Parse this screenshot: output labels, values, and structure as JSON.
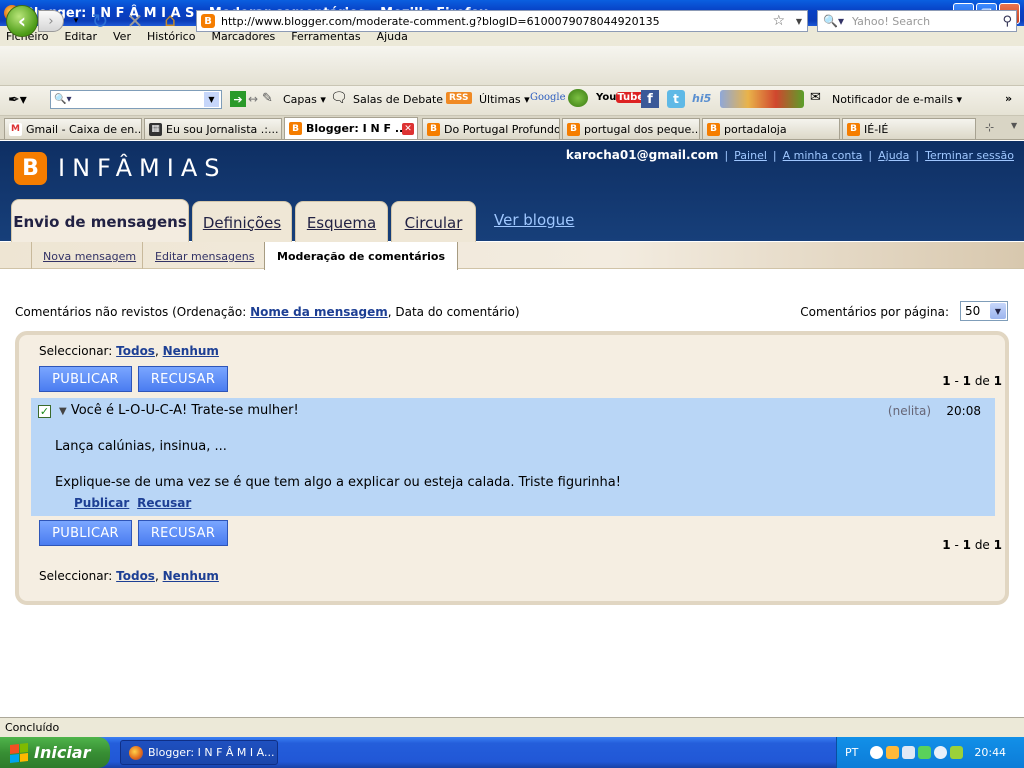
{
  "window": {
    "title": "Blogger: I N F Â M I A S - Moderar comentários - Mozilla Firefox"
  },
  "menu": [
    "Ficheiro",
    "Editar",
    "Ver",
    "Histórico",
    "Marcadores",
    "Ferramentas",
    "Ajuda"
  ],
  "nav": {
    "url": "http://www.blogger.com/moderate-comment.g?blogID=6100079078044920135",
    "search_placeholder": "Yahoo! Search"
  },
  "toolbar2": {
    "capas": "Capas",
    "salas": "Salas de Debate",
    "rss": "RSS",
    "ultimas": "Últimas",
    "google": "Google",
    "notificador": "Notificador de e-mails"
  },
  "tabs": [
    {
      "label": "Gmail - Caixa de en..."
    },
    {
      "label": "Eu sou Jornalista .:..."
    },
    {
      "label": "Blogger: I N F ..."
    },
    {
      "label": "Do Portugal Profundo"
    },
    {
      "label": "portugal dos peque..."
    },
    {
      "label": "portadaloja"
    },
    {
      "label": "IÉ-IÉ"
    }
  ],
  "blog": {
    "name": "INFÂMIAS",
    "email": "karocha01@gmail.com",
    "links": [
      "Painel",
      "A minha conta",
      "Ajuda",
      "Terminar sessão"
    ],
    "main_tabs": [
      "Envio de mensagens",
      "Definições",
      "Esquema",
      "Circular"
    ],
    "view_blog": "Ver blogue",
    "sub_tabs": [
      "Nova mensagem",
      "Editar mensagens",
      "Moderação de comentários"
    ]
  },
  "moderation": {
    "sort_prefix": "Comentários não revistos (Ordenação:",
    "sort_name": "Nome da mensagem",
    "sort_rest": ", Data do comentário)",
    "per_page_label": "Comentários por página:",
    "per_page_value": "50",
    "select_label": "Seleccionar:",
    "select_all": "Todos",
    "select_none": "Nenhum",
    "publish": "PUBLICAR",
    "reject": "RECUSAR",
    "pager": {
      "from": "1",
      "to": "1",
      "of": "de",
      "total": "1"
    }
  },
  "comment": {
    "title": "Você é L-O-U-C-A! Trate-se mulher!",
    "author": "(nelita)",
    "time": "20:08",
    "line1": "Lança calúnias, insinua, ...",
    "line2": "Explique-se de uma vez se é que tem algo a explicar ou esteja calada. Triste figurinha!",
    "action_publish": "Publicar",
    "action_reject": "Recusar"
  },
  "status": "Concluído",
  "taskbar": {
    "start": "Iniciar",
    "item": "Blogger: I N F Â M I A...",
    "lang": "PT",
    "clock": "20:44"
  },
  "colors": {
    "blogger_orange": "#f57d00",
    "header_navy": "#0e2f63",
    "button_blue": "#4a7cf0",
    "comment_bg": "#b9d6f6"
  }
}
